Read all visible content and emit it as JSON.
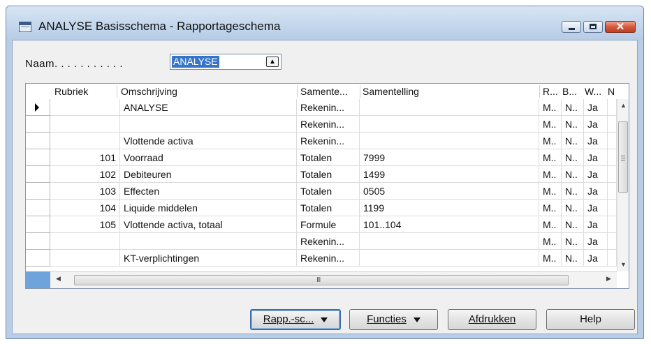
{
  "window": {
    "title": "ANALYSE Basisschema - Rapportageschema",
    "close_glyph": "✕"
  },
  "form": {
    "naam_label": "Naam. . . . . . . . . . .",
    "naam_value": "ANALYSE"
  },
  "grid": {
    "columns": [
      "Rubriek",
      "Omschrijving",
      "Samente...",
      "Samentelling",
      "R...",
      "B...",
      "W...",
      "N"
    ],
    "rows": [
      {
        "rubriek": "",
        "omschrijving": "ANALYSE",
        "samentellingtype": "Rekenin...",
        "samentelling": "",
        "r": "M..",
        "b": "N..",
        "w": "Ja",
        "current": true
      },
      {
        "rubriek": "",
        "omschrijving": "",
        "samentellingtype": "Rekenin...",
        "samentelling": "",
        "r": "M..",
        "b": "N..",
        "w": "Ja",
        "current": false
      },
      {
        "rubriek": "",
        "omschrijving": "Vlottende activa",
        "samentellingtype": "Rekenin...",
        "samentelling": "",
        "r": "M..",
        "b": "N..",
        "w": "Ja",
        "current": false
      },
      {
        "rubriek": "101",
        "omschrijving": "Voorraad",
        "samentellingtype": "Totalen",
        "samentelling": "7999",
        "r": "M..",
        "b": "N..",
        "w": "Ja",
        "current": false
      },
      {
        "rubriek": "102",
        "omschrijving": "Debiteuren",
        "samentellingtype": "Totalen",
        "samentelling": "1499",
        "r": "M..",
        "b": "N..",
        "w": "Ja",
        "current": false
      },
      {
        "rubriek": "103",
        "omschrijving": "Effecten",
        "samentellingtype": "Totalen",
        "samentelling": "0505",
        "r": "M..",
        "b": "N..",
        "w": "Ja",
        "current": false
      },
      {
        "rubriek": "104",
        "omschrijving": "Liquide middelen",
        "samentellingtype": "Totalen",
        "samentelling": "1199",
        "r": "M..",
        "b": "N..",
        "w": "Ja",
        "current": false
      },
      {
        "rubriek": "105",
        "omschrijving": "Vlottende activa, totaal",
        "samentellingtype": "Formule",
        "samentelling": "101..104",
        "r": "M..",
        "b": "N..",
        "w": "Ja",
        "current": false
      },
      {
        "rubriek": "",
        "omschrijving": "",
        "samentellingtype": "Rekenin...",
        "samentelling": "",
        "r": "M..",
        "b": "N..",
        "w": "Ja",
        "current": false
      },
      {
        "rubriek": "",
        "omschrijving": "KT-verplichtingen",
        "samentellingtype": "Rekenin...",
        "samentelling": "",
        "r": "M..",
        "b": "N..",
        "w": "Ja",
        "current": false
      }
    ],
    "hscroll_grip": "III"
  },
  "buttons": {
    "rapp": "Rapp.-sc...",
    "functies": "Functies",
    "afdrukken": "Afdrukken",
    "help": "Help"
  },
  "colors": {
    "window_frame": "#b9cde6",
    "selection": "#3574c6",
    "close_button": "#c13e22"
  }
}
